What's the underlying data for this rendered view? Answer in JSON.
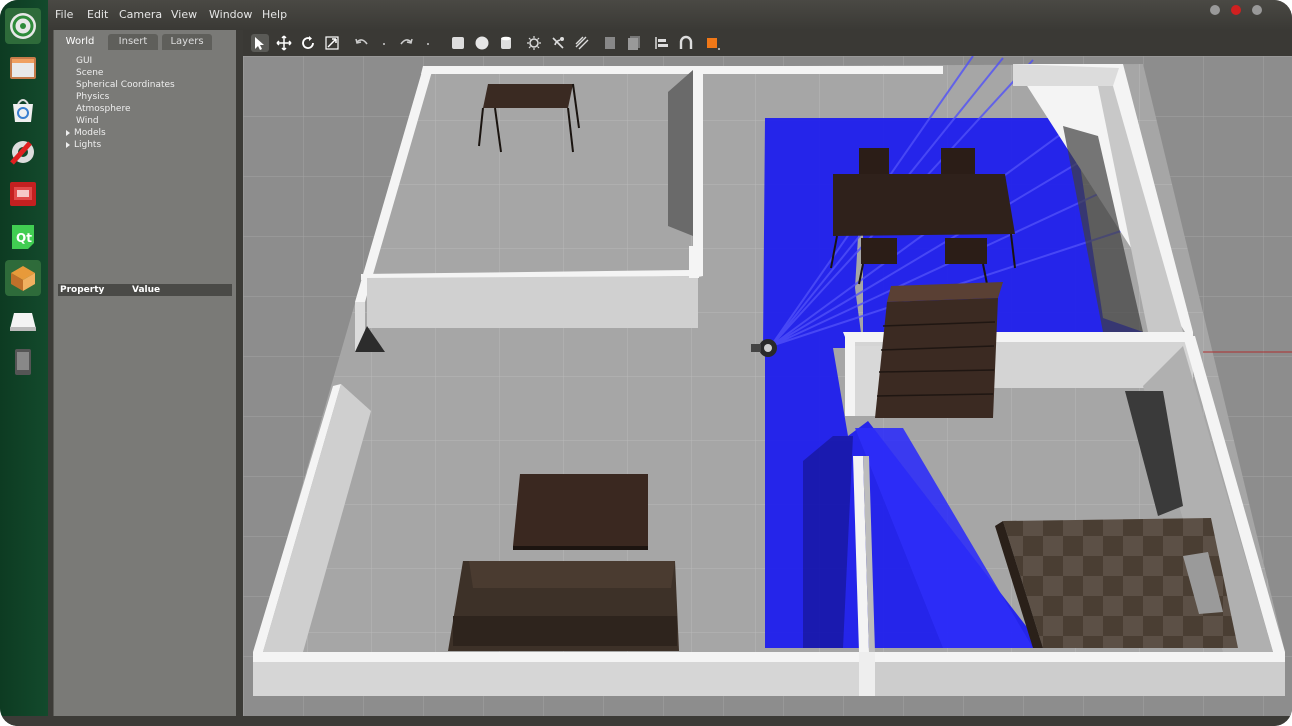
{
  "menu": {
    "file": "File",
    "edit": "Edit",
    "camera": "Camera",
    "view": "View",
    "window": "Window",
    "help": "Help"
  },
  "left_panel": {
    "tabs": [
      "World",
      "Insert",
      "Layers"
    ],
    "tree": [
      "GUI",
      "Scene",
      "Spherical Coordinates",
      "Physics",
      "Atmosphere",
      "Wind",
      "Models",
      "Lights"
    ],
    "property_header": "Property",
    "value_header": "Value"
  },
  "launcher": [
    "ubuntu-dash-icon",
    "files-icon",
    "software-center-icon",
    "settings-icon",
    "presentation-icon",
    "qt-creator-icon",
    "gazebo-icon",
    "drive-icon",
    "phone-icon"
  ],
  "toolbar": [
    "select-arrow-icon",
    "translate-icon",
    "rotate-icon",
    "scale-icon",
    "undo-icon",
    "undo-dropdown-icon",
    "redo-icon",
    "redo-dropdown-icon",
    "box-icon",
    "sphere-icon",
    "cylinder-icon",
    "point-light-icon",
    "spot-light-icon",
    "directional-light-icon",
    "copy-icon",
    "paste-icon",
    "align-icon",
    "snap-icon",
    "change-view-icon"
  ],
  "colors": {
    "launcher_bg": "#134a2c",
    "panel_bg": "#7a7a77",
    "toolbar_bg": "#3a3935",
    "laser_blue": "#1a1aff",
    "accent_orange": "#f07818"
  }
}
